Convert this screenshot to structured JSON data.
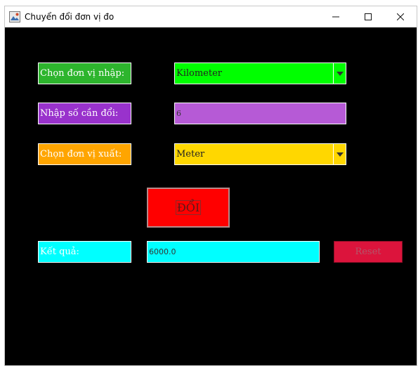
{
  "window": {
    "title": "Chuyển đổi đơn vị đo",
    "controls": {
      "minimize": "minimize-icon",
      "maximize": "maximize-icon",
      "close": "close-icon"
    }
  },
  "form": {
    "input_unit": {
      "label": "Chọn đơn vị nhập:",
      "selected": "Kilometer"
    },
    "number": {
      "label": "Nhập số cần đổi:",
      "value": "6"
    },
    "output_unit": {
      "label": "Chọn đơn vị xuất:",
      "selected": "Meter"
    },
    "convert_button": "ĐỔI",
    "result": {
      "label": "Kết quả:",
      "value": "6000.0"
    },
    "reset_button": "Reset"
  },
  "colors": {
    "background": "#000000",
    "label_input_unit": "#2DB52D",
    "combo_input_unit": "#00FF00",
    "label_number": "#9932CC",
    "field_number": "#B65AD6",
    "label_output_unit": "#FFA500",
    "combo_output_unit": "#FFD700",
    "convert_button": "#FF0000",
    "label_result": "#00FFFF",
    "field_result": "#00FFFF",
    "reset_button": "#DC143C"
  }
}
